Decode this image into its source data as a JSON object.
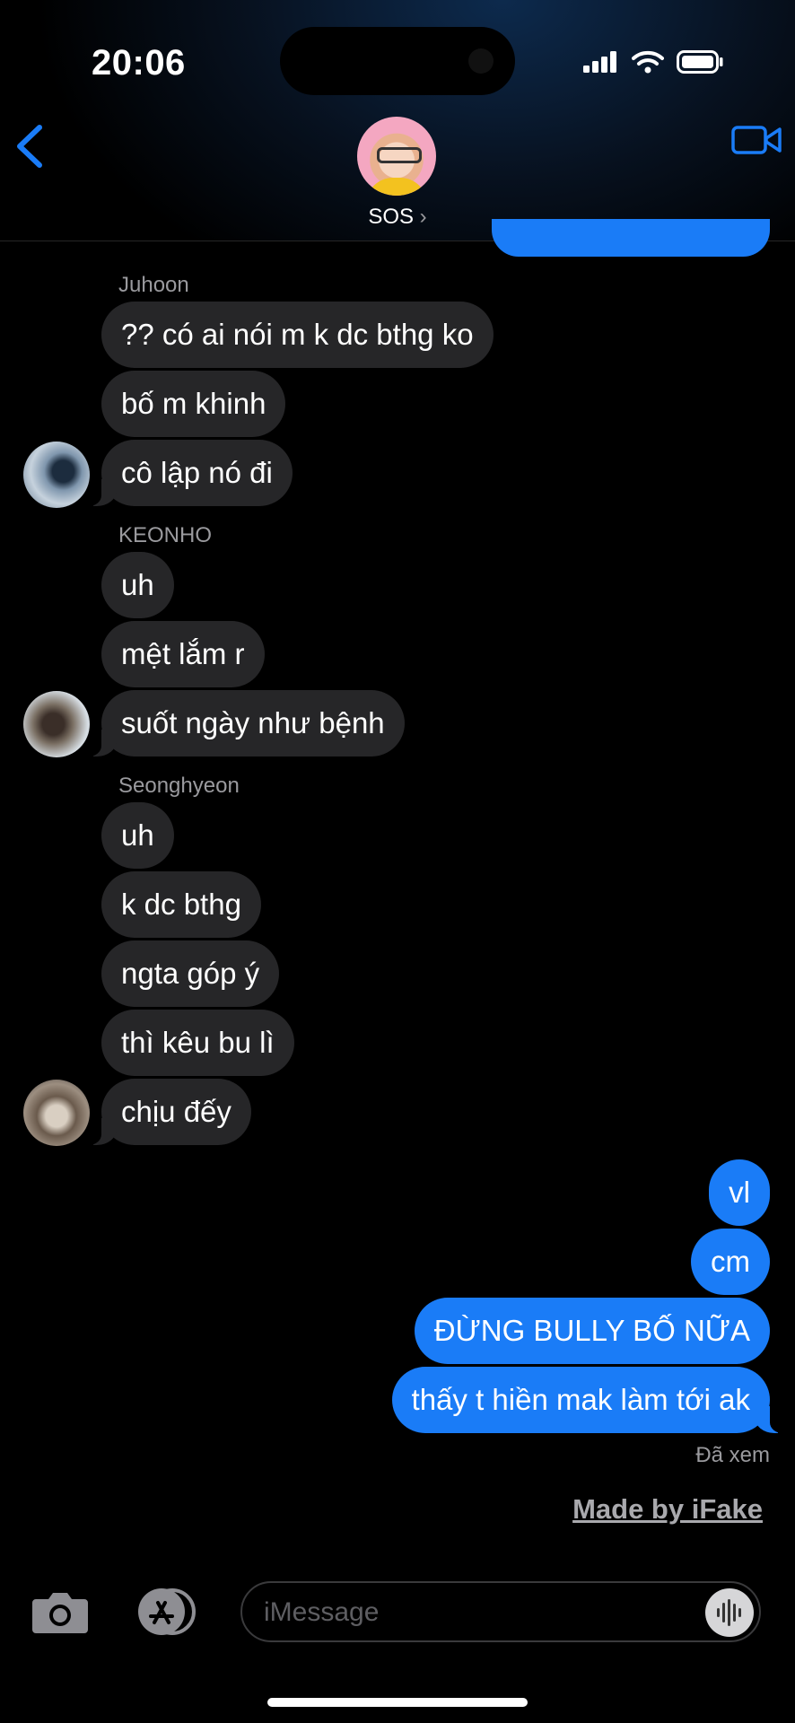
{
  "status": {
    "time": "20:06"
  },
  "header": {
    "group_name": "SOS"
  },
  "groups": [
    {
      "sender": "Juhoon",
      "messages": [
        "?? có ai nói m k dc bthg ko",
        "bố m khinh",
        "cô lập nó đi"
      ]
    },
    {
      "sender": "KEONHO",
      "messages": [
        "uh",
        "mệt lắm r",
        "suốt ngày như bệnh"
      ]
    },
    {
      "sender": "Seonghyeon",
      "messages": [
        "uh",
        "k dc bthg",
        "ngta góp ý",
        "thì kêu bu lì",
        "chịu đếy"
      ]
    }
  ],
  "outgoing": [
    "vl",
    "cm",
    "ĐỪNG BULLY BỐ NỮA",
    "thấy t hiền mak làm tới ak"
  ],
  "read_receipt": "Đã xem",
  "watermark": "Made by iFake",
  "composer": {
    "placeholder": "iMessage"
  },
  "icons": [
    "back-chevron-icon",
    "video-camera-icon",
    "camera-icon",
    "app-store-icon",
    "audio-waveform-icon",
    "signal-icon",
    "wifi-icon",
    "battery-icon"
  ],
  "colors": {
    "accent": "#1a7cf7",
    "incoming_bubble": "#262628",
    "background": "#000000"
  }
}
